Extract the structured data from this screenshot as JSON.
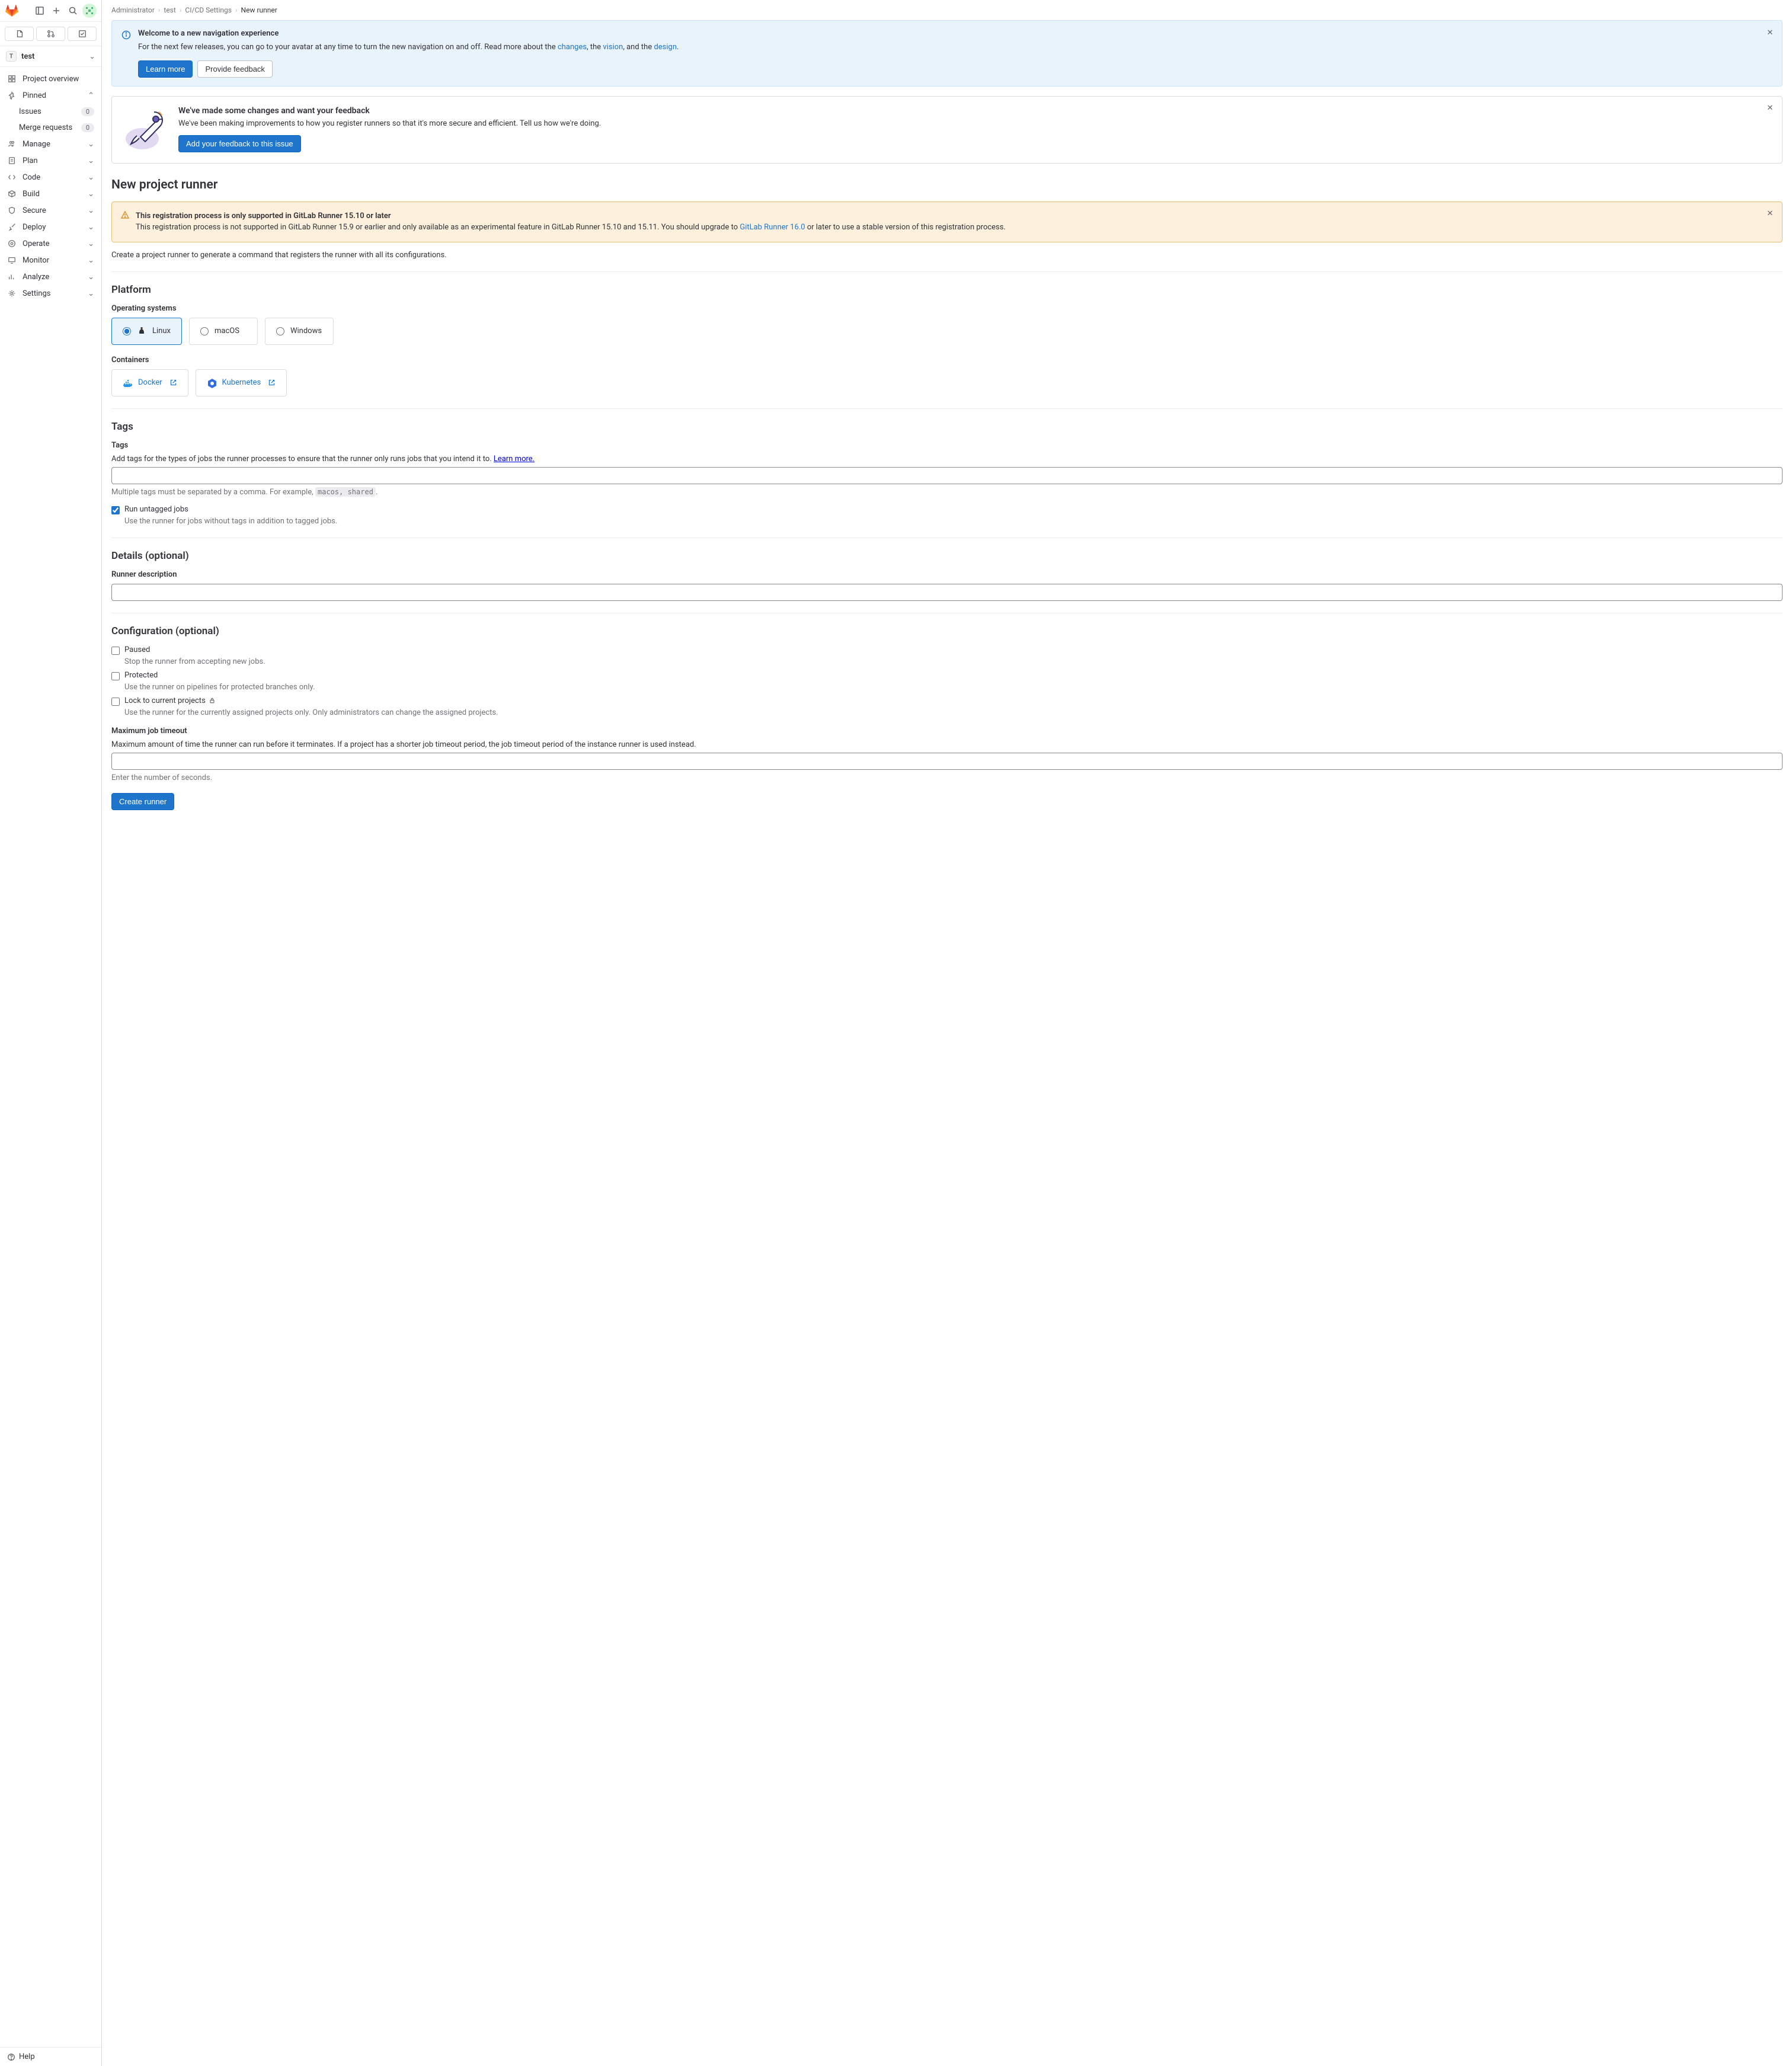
{
  "breadcrumb": {
    "items": [
      "Administrator",
      "test",
      "CI/CD Settings",
      "New runner"
    ]
  },
  "sidebar": {
    "project_letter": "T",
    "project_name": "test",
    "overview": "Project overview",
    "pinned": "Pinned",
    "issues": "Issues",
    "issues_count": "0",
    "merge_requests": "Merge requests",
    "mr_count": "0",
    "manage": "Manage",
    "plan": "Plan",
    "code": "Code",
    "build": "Build",
    "secure": "Secure",
    "deploy": "Deploy",
    "operate": "Operate",
    "monitor": "Monitor",
    "analyze": "Analyze",
    "settings": "Settings",
    "help": "Help"
  },
  "nav_banner": {
    "title": "Welcome to a new navigation experience",
    "text_a": "For the next few releases, you can go to your avatar at any time to turn the new navigation on and off. Read more about the ",
    "link_changes": "changes",
    "text_b": ", the ",
    "link_vision": "vision",
    "text_c": ", and the ",
    "link_design": "design",
    "text_d": ".",
    "learn_more": "Learn more",
    "provide_feedback": "Provide feedback"
  },
  "feedback_box": {
    "title": "We've made some changes and want your feedback",
    "text": "We've been making improvements to how you register runners so that it's more secure and efficient. Tell us how we're doing.",
    "cta": "Add your feedback to this issue"
  },
  "page_title": "New project runner",
  "warn": {
    "title": "This registration process is only supported in GitLab Runner 15.10 or later",
    "text_a": "This registration process is not supported in GitLab Runner 15.9 or earlier and only available as an experimental feature in GitLab Runner 15.10 and 15.11. You should upgrade to ",
    "link": "GitLab Runner 16.0",
    "text_b": " or later to use a stable version of this registration process."
  },
  "intro": "Create a project runner to generate a command that registers the runner with all its configurations.",
  "platform": {
    "heading": "Platform",
    "os_label": "Operating systems",
    "linux": "Linux",
    "macos": "macOS",
    "windows": "Windows",
    "containers_label": "Containers",
    "docker": "Docker",
    "kubernetes": "Kubernetes"
  },
  "tags": {
    "heading": "Tags",
    "label": "Tags",
    "desc_a": "Add tags for the types of jobs the runner processes to ensure that the runner only runs jobs that you intend it to. ",
    "learn_more": "Learn more.",
    "multi_a": "Multiple tags must be separated by a comma. For example, ",
    "multi_code": "macos, shared",
    "multi_b": ".",
    "run_untagged": "Run untagged jobs",
    "run_untagged_desc": "Use the runner for jobs without tags in addition to tagged jobs."
  },
  "details": {
    "heading": "Details (optional)",
    "label": "Runner description"
  },
  "config": {
    "heading": "Configuration (optional)",
    "paused": "Paused",
    "paused_desc": "Stop the runner from accepting new jobs.",
    "protected": "Protected",
    "protected_desc": "Use the runner on pipelines for protected branches only.",
    "lock": "Lock to current projects",
    "lock_desc": "Use the runner for the currently assigned projects only. Only administrators can change the assigned projects.",
    "timeout_label": "Maximum job timeout",
    "timeout_desc": "Maximum amount of time the runner can run before it terminates. If a project has a shorter job timeout period, the job timeout period of the instance runner is used instead.",
    "timeout_help": "Enter the number of seconds."
  },
  "submit": "Create runner"
}
